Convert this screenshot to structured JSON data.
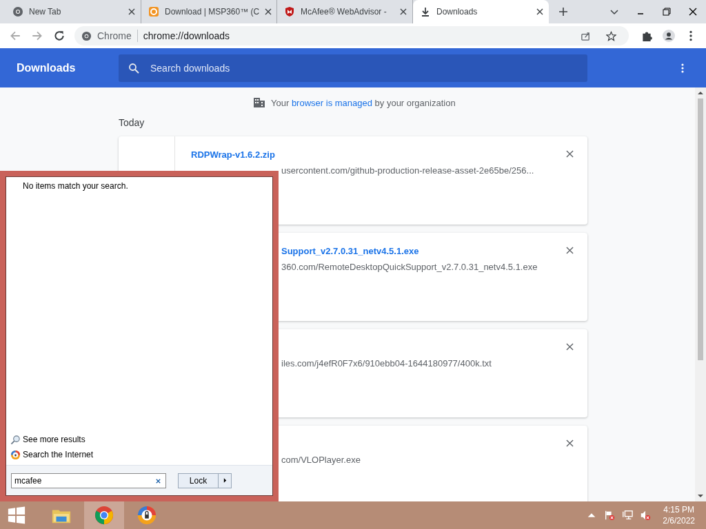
{
  "browser": {
    "tabs": [
      {
        "kind": "chrome",
        "title": "New Tab",
        "selected": false
      },
      {
        "kind": "msp",
        "title": "Download | MSP360™ (C",
        "selected": false
      },
      {
        "kind": "mcafee",
        "title": "McAfee® WebAdvisor -",
        "selected": false
      },
      {
        "kind": "download",
        "title": "Downloads",
        "selected": true
      }
    ],
    "address_bar": {
      "site_label": "Chrome",
      "url": "chrome://downloads"
    }
  },
  "downloads_page": {
    "title": "Downloads",
    "search": {
      "placeholder": "Search downloads"
    },
    "managed_notice": {
      "before": "Your",
      "link": "browser is managed",
      "after": "by your organization"
    },
    "date_group": "Today",
    "items": [
      {
        "name": "RDPWrap-v1.6.2.zip",
        "url": "usercontent.com/github-production-release-asset-2e65be/256..."
      },
      {
        "name": "Support_v2.7.0.31_netv4.5.1.exe",
        "url": "360.com/RemoteDesktopQuickSupport_v2.7.0.31_netv4.5.1.exe"
      },
      {
        "url": "iles.com/j4efR0F7x6/910ebb04-1644180977/400k.txt"
      },
      {
        "url": "com/VLOPlayer.exe"
      }
    ]
  },
  "start_menu": {
    "message": "No items match your search.",
    "links": [
      {
        "kind": "search",
        "label": "See more results"
      },
      {
        "kind": "internet",
        "label": "Search the Internet"
      }
    ],
    "search": {
      "value": "mcafee"
    },
    "power_button": "Lock"
  },
  "taskbar": {
    "apps": [
      {
        "kind": "explorer",
        "selected": false
      },
      {
        "kind": "chrome",
        "selected": true
      },
      {
        "kind": "secure-browser",
        "selected": false
      }
    ],
    "clock": {
      "time": "4:15 PM",
      "date": "2/6/2022"
    }
  }
}
